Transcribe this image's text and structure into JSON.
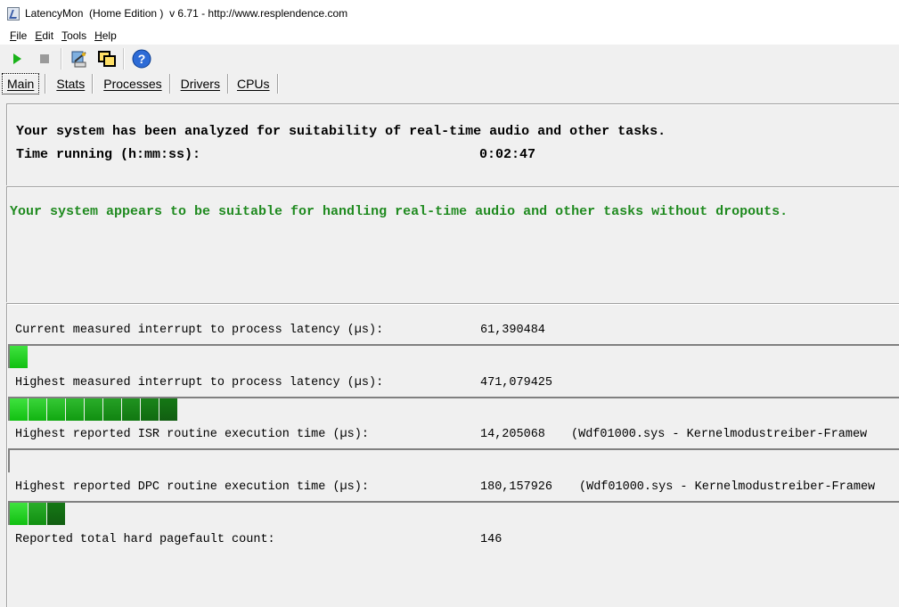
{
  "window": {
    "title": "LatencyMon  (Home Edition )  v 6.71 - http://www.resplendence.com"
  },
  "menu": [
    {
      "label": "File",
      "accel": "F",
      "rest": "ile"
    },
    {
      "label": "Edit",
      "accel": "E",
      "rest": "dit"
    },
    {
      "label": "Tools",
      "accel": "T",
      "rest": "ools"
    },
    {
      "label": "Help",
      "accel": "H",
      "rest": "elp"
    }
  ],
  "toolbar": {
    "icons": [
      "play-icon",
      "stop-icon",
      "measure-icon",
      "windows-icon",
      "help-icon"
    ],
    "colors": {
      "play": "#19b319",
      "stop": "#9a9a9a",
      "help": "#2d6bd6"
    }
  },
  "tabs": [
    "Main",
    "Stats",
    "Processes",
    "Drivers",
    "CPUs"
  ],
  "summary": {
    "line1": "Your system has been analyzed for suitability of real-time audio and other tasks.",
    "time_label": "Time running (h:mm:ss):",
    "time_value": "0:02:47"
  },
  "verdict": {
    "text": "Your system appears to be suitable for handling real-time audio and other tasks without dropouts.",
    "color": "#1f8a1f"
  },
  "metrics": {
    "current_latency": {
      "label": "Current measured interrupt to process latency (µs):",
      "value": "61,390484",
      "level_segments": 1
    },
    "highest_latency": {
      "label": "Highest measured interrupt to process latency (µs):",
      "value": "471,079425",
      "level_segments": 9
    },
    "isr": {
      "label": "Highest reported ISR routine execution time (µs):",
      "value": "14,205068",
      "detail": "(Wdf01000.sys - Kernelmodustreiber-Framew",
      "level_segments": 0
    },
    "dpc": {
      "label": "Highest reported DPC routine execution time (µs):",
      "value": "180,157926",
      "detail": "(Wdf01000.sys - Kernelmodustreiber-Framew",
      "level_segments": 3
    },
    "pagefault": {
      "label": "Reported total hard pagefault count:",
      "value": "146"
    }
  }
}
